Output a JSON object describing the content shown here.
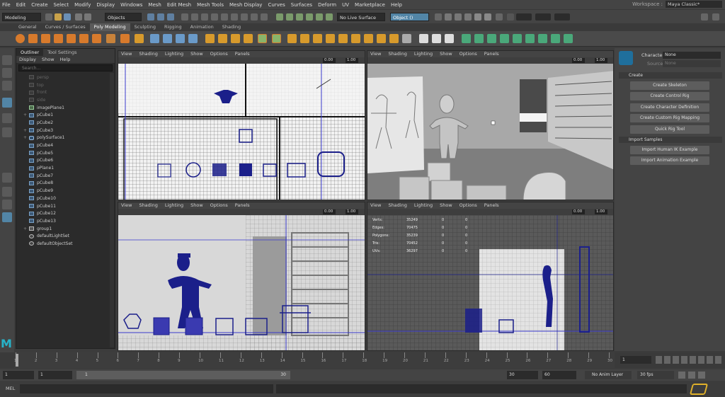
{
  "menubar": {
    "items": [
      "File",
      "Edit",
      "Create",
      "Select",
      "Modify",
      "Display",
      "Windows",
      "Mesh",
      "Edit Mesh",
      "Mesh Tools",
      "Mesh Display",
      "Curves",
      "Surfaces",
      "Deform",
      "UV",
      "Marketplace",
      "Help"
    ],
    "workspace_label": "Workspace :",
    "workspace_value": "Maya Classic*"
  },
  "statusline": {
    "mode": "Modeling",
    "selection_mode": "Objects",
    "live_surface": "No Live Surface",
    "object_field": "Object ()"
  },
  "shelf_tabs": [
    "General",
    "Curves / Surfaces",
    "Poly Modeling",
    "Sculpting",
    "Rigging",
    "Animation",
    "Shading"
  ],
  "shelf_active": "Poly Modeling",
  "outliner": {
    "tabs": [
      "Outliner",
      "Tool Settings"
    ],
    "menu": [
      "Display",
      "Show",
      "Help"
    ],
    "search_placeholder": "Search...",
    "items": [
      {
        "label": "persp",
        "kind": "camera",
        "dim": true
      },
      {
        "label": "top",
        "kind": "camera",
        "dim": true
      },
      {
        "label": "front",
        "kind": "camera",
        "dim": true
      },
      {
        "label": "side",
        "kind": "camera",
        "dim": true
      },
      {
        "label": "imagePlane1",
        "kind": "image",
        "dim": false
      },
      {
        "label": "pCube1",
        "kind": "mesh",
        "dim": false
      },
      {
        "label": "pCube2",
        "kind": "mesh",
        "dim": false
      },
      {
        "label": "pCube3",
        "kind": "mesh",
        "dim": false
      },
      {
        "label": "polySurface1",
        "kind": "surface",
        "dim": false
      },
      {
        "label": "pCube4",
        "kind": "mesh",
        "dim": false
      },
      {
        "label": "pCube5",
        "kind": "mesh",
        "dim": false
      },
      {
        "label": "pCube6",
        "kind": "mesh",
        "dim": false
      },
      {
        "label": "pPlane1",
        "kind": "mesh",
        "dim": false
      },
      {
        "label": "pCube7",
        "kind": "mesh",
        "dim": false
      },
      {
        "label": "pCube8",
        "kind": "mesh",
        "dim": false
      },
      {
        "label": "pCube9",
        "kind": "mesh",
        "dim": false
      },
      {
        "label": "pCube10",
        "kind": "mesh",
        "dim": false
      },
      {
        "label": "pCube11",
        "kind": "mesh",
        "dim": false
      },
      {
        "label": "pCube12",
        "kind": "mesh",
        "dim": false
      },
      {
        "label": "pCube13",
        "kind": "mesh",
        "dim": false
      },
      {
        "label": "group1",
        "kind": "group",
        "dim": false
      },
      {
        "label": "defaultLightSet",
        "kind": "set",
        "dim": false
      },
      {
        "label": "defaultObjectSet",
        "kind": "set",
        "dim": false
      }
    ]
  },
  "viewport": {
    "menu": [
      "View",
      "Shading",
      "Lighting",
      "Show",
      "Options",
      "Panels"
    ],
    "field_a": "0.00",
    "field_b": "1.00"
  },
  "hud": {
    "rows": [
      {
        "label": "Verts:",
        "v1": "35249",
        "v2": "0",
        "v3": "0"
      },
      {
        "label": "Edges:",
        "v1": "70475",
        "v2": "0",
        "v3": "0"
      },
      {
        "label": "Polygons:",
        "v1": "35239",
        "v2": "0",
        "v3": "0"
      },
      {
        "label": "Tris:",
        "v1": "70452",
        "v2": "0",
        "v3": "0"
      },
      {
        "label": "UVs:",
        "v1": "36297",
        "v2": "0",
        "v3": "0"
      }
    ]
  },
  "hik": {
    "character_label": "Character:",
    "character_value": "None",
    "source_label": "Source:",
    "source_value": "None",
    "create_header": "Create",
    "create_buttons": [
      "Create Skeleton",
      "Create Control Rig",
      "Create Character Definition",
      "Create Custom Rig Mapping",
      "Quick Rig Tool"
    ],
    "import_header": "Import Samples",
    "import_buttons": [
      "Import Human IK Example",
      "Import Animation Example"
    ]
  },
  "timeline": {
    "ticks": [
      "1",
      "2",
      "3",
      "4",
      "5",
      "6",
      "7",
      "8",
      "9",
      "10",
      "11",
      "12",
      "13",
      "14",
      "15",
      "16",
      "17",
      "18",
      "19",
      "20",
      "21",
      "22",
      "23",
      "24",
      "25",
      "26",
      "27",
      "28",
      "29",
      "30"
    ],
    "current_frame": "1",
    "range_start": "1",
    "range_inner_start": "1",
    "range_bar_start": "1",
    "range_bar_end": "30",
    "range_inner_end": "30",
    "range_end": "60",
    "anim_layer": "No Anim Layer",
    "fps": "30 fps"
  },
  "cmdline": {
    "label": "MEL"
  },
  "colors": {
    "accent": "#5285a6",
    "wireframe": "#1b1f8a",
    "blue_line": "#3a3acd"
  }
}
